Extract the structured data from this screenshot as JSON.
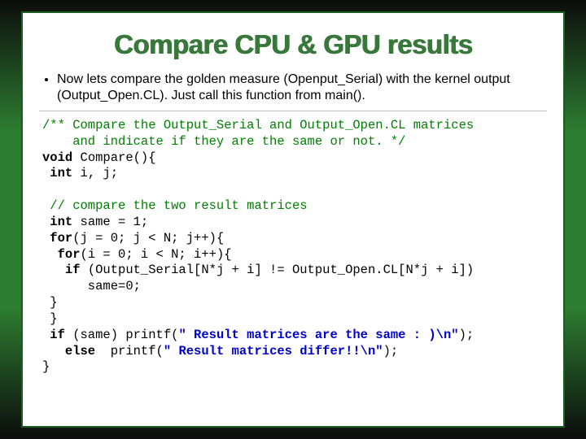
{
  "title": "Compare CPU & GPU results",
  "bullet": "Now lets compare the golden measure (Openput_Serial) with the kernel output (Output_Open.CL). Just call this function from main().",
  "code": {
    "c1a": "/** Compare the Output_Serial and Output_Open.CL matrices",
    "c1b": "    and indicate if they are the same or not. */",
    "k_void": "void",
    "l2": " Compare(){",
    "k_int1": " int",
    "l3": " i, j;",
    "c2": " // compare the two result matrices",
    "k_int2": " int",
    "l4": " same = 1;",
    "k_for1": " for",
    "l5": "(j = 0; j < N; j++){",
    "k_for2": "  for",
    "l6": "(i = 0; i < N; i++){",
    "k_if1": "   if",
    "l7": " (Output_Serial[N*j + i] != Output_Open.CL[N*j + i])",
    "l8": "      same=0;",
    "l9": " }",
    "l10": " }",
    "k_if2": " if",
    "l11a": " (same) printf(",
    "s1": "\" Result matrices are the same : )\\n\"",
    "l11b": ");",
    "k_else": "   else",
    "l12a": "  printf(",
    "s2": "\" Result matrices differ!!\\n\"",
    "l12b": ");",
    "l13": "}"
  }
}
